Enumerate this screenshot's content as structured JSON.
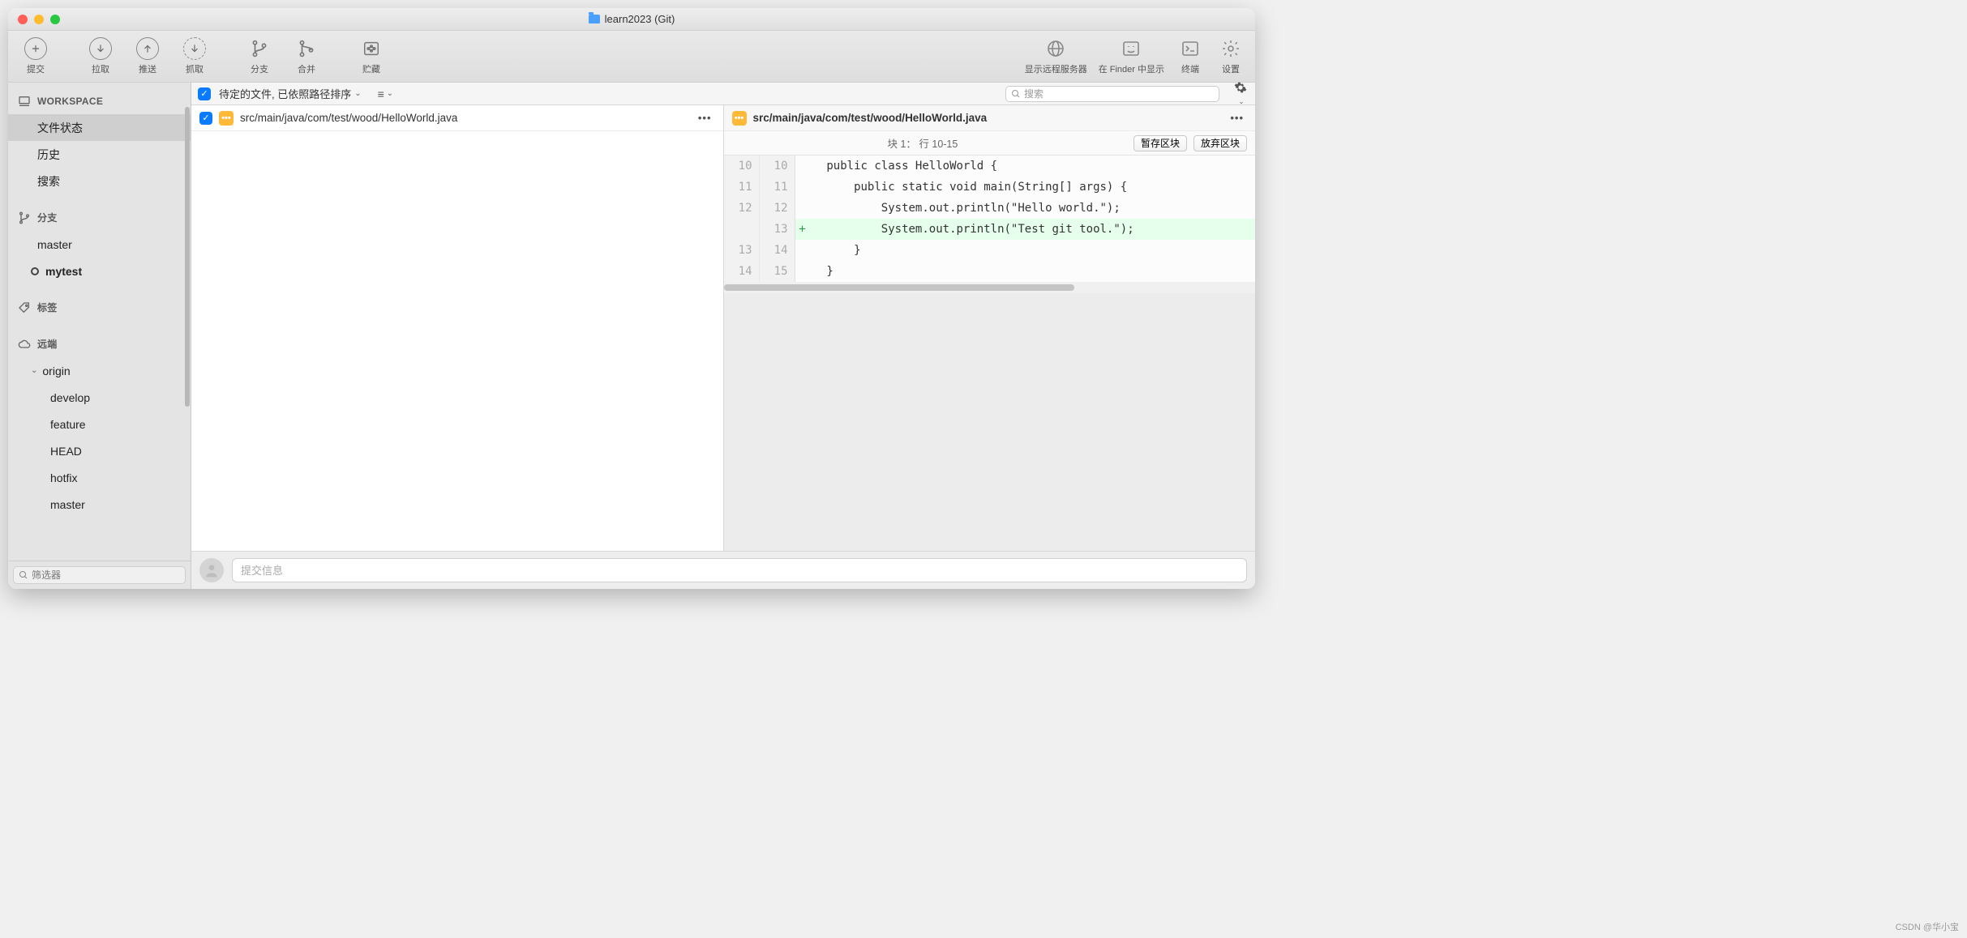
{
  "window": {
    "title": "learn2023 (Git)"
  },
  "toolbar": {
    "commit": "提交",
    "pull": "拉取",
    "push": "推送",
    "fetch": "抓取",
    "branch": "分支",
    "merge": "合并",
    "stash": "贮藏",
    "remote": "显示远程服务器",
    "finder": "在 Finder 中显示",
    "terminal": "终端",
    "settings": "设置"
  },
  "sidebar": {
    "workspace_label": "WORKSPACE",
    "file_status": "文件状态",
    "history": "历史",
    "search": "搜索",
    "branches_label": "分支",
    "branches": [
      {
        "name": "master",
        "current": false
      },
      {
        "name": "mytest",
        "current": true
      }
    ],
    "tags_label": "标签",
    "remotes_label": "远端",
    "remotes": [
      {
        "name": "origin",
        "children": [
          "develop",
          "feature",
          "HEAD",
          "hotfix",
          "master"
        ]
      }
    ],
    "filter_placeholder": "筛选器"
  },
  "filterbar": {
    "sort_label": "待定的文件, 已依照路径排序",
    "search_placeholder": "搜索"
  },
  "file": {
    "path": "src/main/java/com/test/wood/HelloWorld.java"
  },
  "diff": {
    "hunk_label": "块 1： 行 10-15",
    "stage_btn": "暂存区块",
    "discard_btn": "放弃区块",
    "lines": [
      {
        "old": "10",
        "new": "10",
        "m": " ",
        "t": "public class HelloWorld {"
      },
      {
        "old": "11",
        "new": "11",
        "m": " ",
        "t": "    public static void main(String[] args) {"
      },
      {
        "old": "12",
        "new": "12",
        "m": " ",
        "t": "        System.out.println(\"Hello world.\");"
      },
      {
        "old": "",
        "new": "13",
        "m": "+",
        "t": "        System.out.println(\"Test git tool.\");"
      },
      {
        "old": "13",
        "new": "14",
        "m": " ",
        "t": "    }"
      },
      {
        "old": "14",
        "new": "15",
        "m": " ",
        "t": "}"
      }
    ]
  },
  "commit": {
    "placeholder": "提交信息"
  },
  "watermark": "CSDN @华小宝"
}
